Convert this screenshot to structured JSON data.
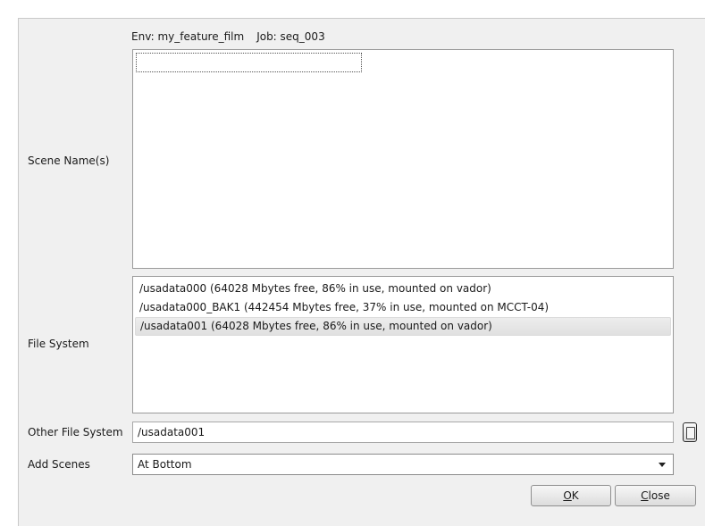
{
  "header": {
    "env_text": "Env: my_feature_film",
    "job_text": "Job: seq_003"
  },
  "labels": {
    "scene_names": "Scene Name(s)",
    "file_system": "File System",
    "other_file_system": "Other File System",
    "add_scenes": "Add Scenes"
  },
  "file_systems": [
    {
      "text": "/usadata000  (64028 Mbytes free, 86% in use, mounted on vador)",
      "selected": false
    },
    {
      "text": "/usadata000_BAK1  (442454 Mbytes free, 37% in use, mounted on MCCT-04)",
      "selected": false
    },
    {
      "text": "/usadata001  (64028 Mbytes free, 86% in use, mounted on vador)",
      "selected": true
    }
  ],
  "other_file_system_value": "/usadata001",
  "add_scenes_value": "At Bottom",
  "buttons": {
    "ok_mnemonic": "O",
    "ok_rest": "K",
    "close_mnemonic": "C",
    "close_rest": "lose"
  },
  "icons": {
    "browse": "browse-icon",
    "dropdown": "chevron-down-icon"
  }
}
